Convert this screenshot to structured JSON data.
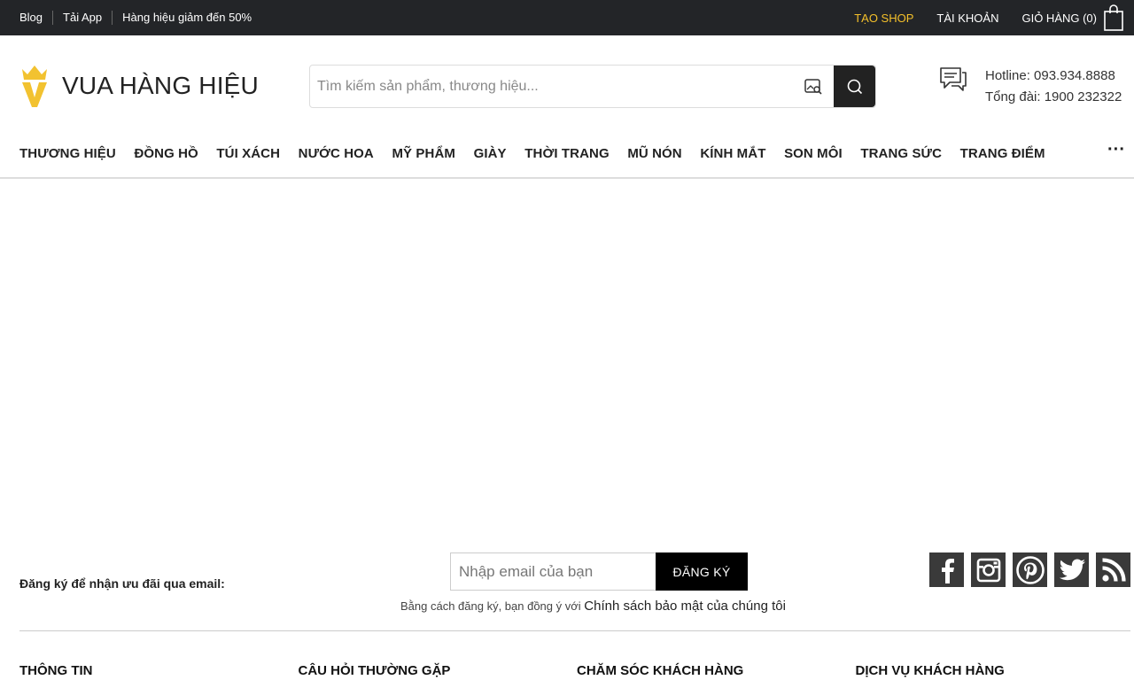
{
  "topbar": {
    "links_left": [
      "Blog",
      "Tải App",
      "Hàng hiệu giảm đến 50%"
    ],
    "shop": "TẠO SHOP",
    "account": "TÀI KHOẢN",
    "cart": "GIỎ HÀNG (0)"
  },
  "header": {
    "logo_text": "VUA HÀNG HIỆU",
    "search_placeholder": "Tìm kiếm sản phẩm, thương hiệu...",
    "hotline": "Hotline: 093.934.8888",
    "switchboard": "Tổng đài: 1900 232322"
  },
  "nav": {
    "items": [
      "THƯƠNG HIỆU",
      "ĐỒNG HỒ",
      "TÚI XÁCH",
      "NƯỚC HOA",
      "MỸ PHẨM",
      "GIÀY",
      "THỜI TRANG",
      "MŨ NÓN",
      "KÍNH MẮT",
      "SON MÔI",
      "TRANG SỨC",
      "TRANG ĐIỂM"
    ],
    "more": "···"
  },
  "newsletter": {
    "label": "Đăng ký để nhận ưu đãi qua email:",
    "email_placeholder": "Nhập email của bạn",
    "button": "ĐĂNG KÝ",
    "note": "Bằng cách đăng ký, bạn đồng ý với",
    "policy_link": "Chính sách bảo mật của chúng tôi"
  },
  "social_icons": [
    "facebook-icon",
    "instagram-icon",
    "pinterest-icon",
    "twitter-icon",
    "rss-icon"
  ],
  "footer": {
    "columns": [
      "THÔNG TIN",
      "CÂU HỎI THƯỜNG GẶP",
      "CHĂM SÓC KHÁCH HÀNG",
      "DỊCH VỤ KHÁCH HÀNG"
    ]
  },
  "colors": {
    "topbar_bg": "#232528",
    "accent_gold": "#f4c02a",
    "logo_gold": "#f2c230",
    "social_bg": "#3a3a3a"
  }
}
